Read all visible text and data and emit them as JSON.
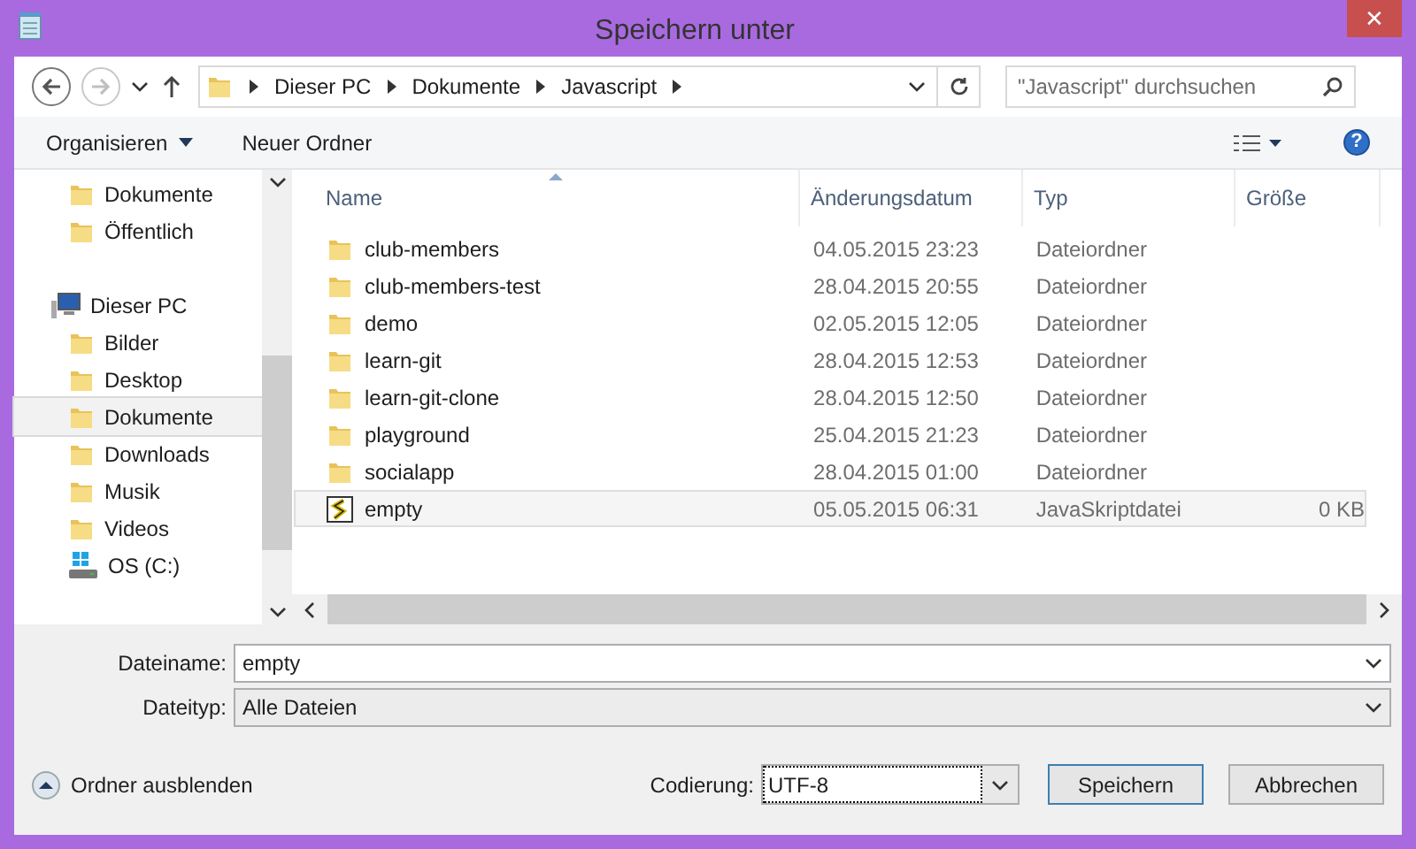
{
  "window": {
    "title": "Speichern unter",
    "close": "✕"
  },
  "nav": {
    "back": {
      "disabled": false
    },
    "forward": {
      "disabled": true
    }
  },
  "breadcrumb": [
    "Dieser PC",
    "Dokumente",
    "Javascript"
  ],
  "search": {
    "placeholder": "\"Javascript\" durchsuchen"
  },
  "toolbar": {
    "organize": "Organisieren",
    "new_folder": "Neuer Ordner",
    "help": "?"
  },
  "sidebar": {
    "items": [
      {
        "label": "Dokumente",
        "kind": "folder",
        "selected": false
      },
      {
        "label": "Öffentlich",
        "kind": "folder",
        "selected": false
      },
      {
        "label": "Dieser PC",
        "kind": "pc",
        "selected": false,
        "children": [
          {
            "label": "Bilder",
            "kind": "folder",
            "selected": false
          },
          {
            "label": "Desktop",
            "kind": "folder",
            "selected": false
          },
          {
            "label": "Dokumente",
            "kind": "folder",
            "selected": true
          },
          {
            "label": "Downloads",
            "kind": "folder",
            "selected": false
          },
          {
            "label": "Musik",
            "kind": "folder",
            "selected": false
          },
          {
            "label": "Videos",
            "kind": "folder",
            "selected": false
          },
          {
            "label": "OS (C:)",
            "kind": "drive",
            "selected": false
          }
        ]
      }
    ]
  },
  "table": {
    "columns": [
      "Name",
      "Änderungsdatum",
      "Typ",
      "Größe"
    ],
    "rows": [
      {
        "name": "club-members",
        "date": "04.05.2015 23:23",
        "type": "Dateiordner",
        "kind": "folder",
        "selected": false
      },
      {
        "name": "club-members-test",
        "date": "28.04.2015 20:55",
        "type": "Dateiordner",
        "kind": "folder",
        "selected": false
      },
      {
        "name": "demo",
        "date": "02.05.2015 12:05",
        "type": "Dateiordner",
        "kind": "folder",
        "selected": false
      },
      {
        "name": "learn-git",
        "date": "28.04.2015 12:53",
        "type": "Dateiordner",
        "kind": "folder",
        "selected": false
      },
      {
        "name": "learn-git-clone",
        "date": "28.04.2015 12:50",
        "type": "Dateiordner",
        "kind": "folder",
        "selected": false
      },
      {
        "name": "playground",
        "date": "25.04.2015 21:23",
        "type": "Dateiordner",
        "kind": "folder",
        "selected": false
      },
      {
        "name": "socialapp",
        "date": "28.04.2015 01:00",
        "type": "Dateiordner",
        "kind": "folder",
        "selected": false
      },
      {
        "name": "empty",
        "date": "05.05.2015 06:31",
        "type": "JavaSkriptdatei",
        "size": "0 KB",
        "kind": "script",
        "selected": true
      }
    ]
  },
  "filename": {
    "label": "Dateiname:",
    "value": "empty"
  },
  "filetype": {
    "label": "Dateityp:",
    "value": "Alle Dateien"
  },
  "hide_folders": "Ordner ausblenden",
  "encoding": {
    "label": "Codierung:",
    "value": "UTF-8"
  },
  "buttons": [
    "Speichern",
    "Abbrechen"
  ]
}
